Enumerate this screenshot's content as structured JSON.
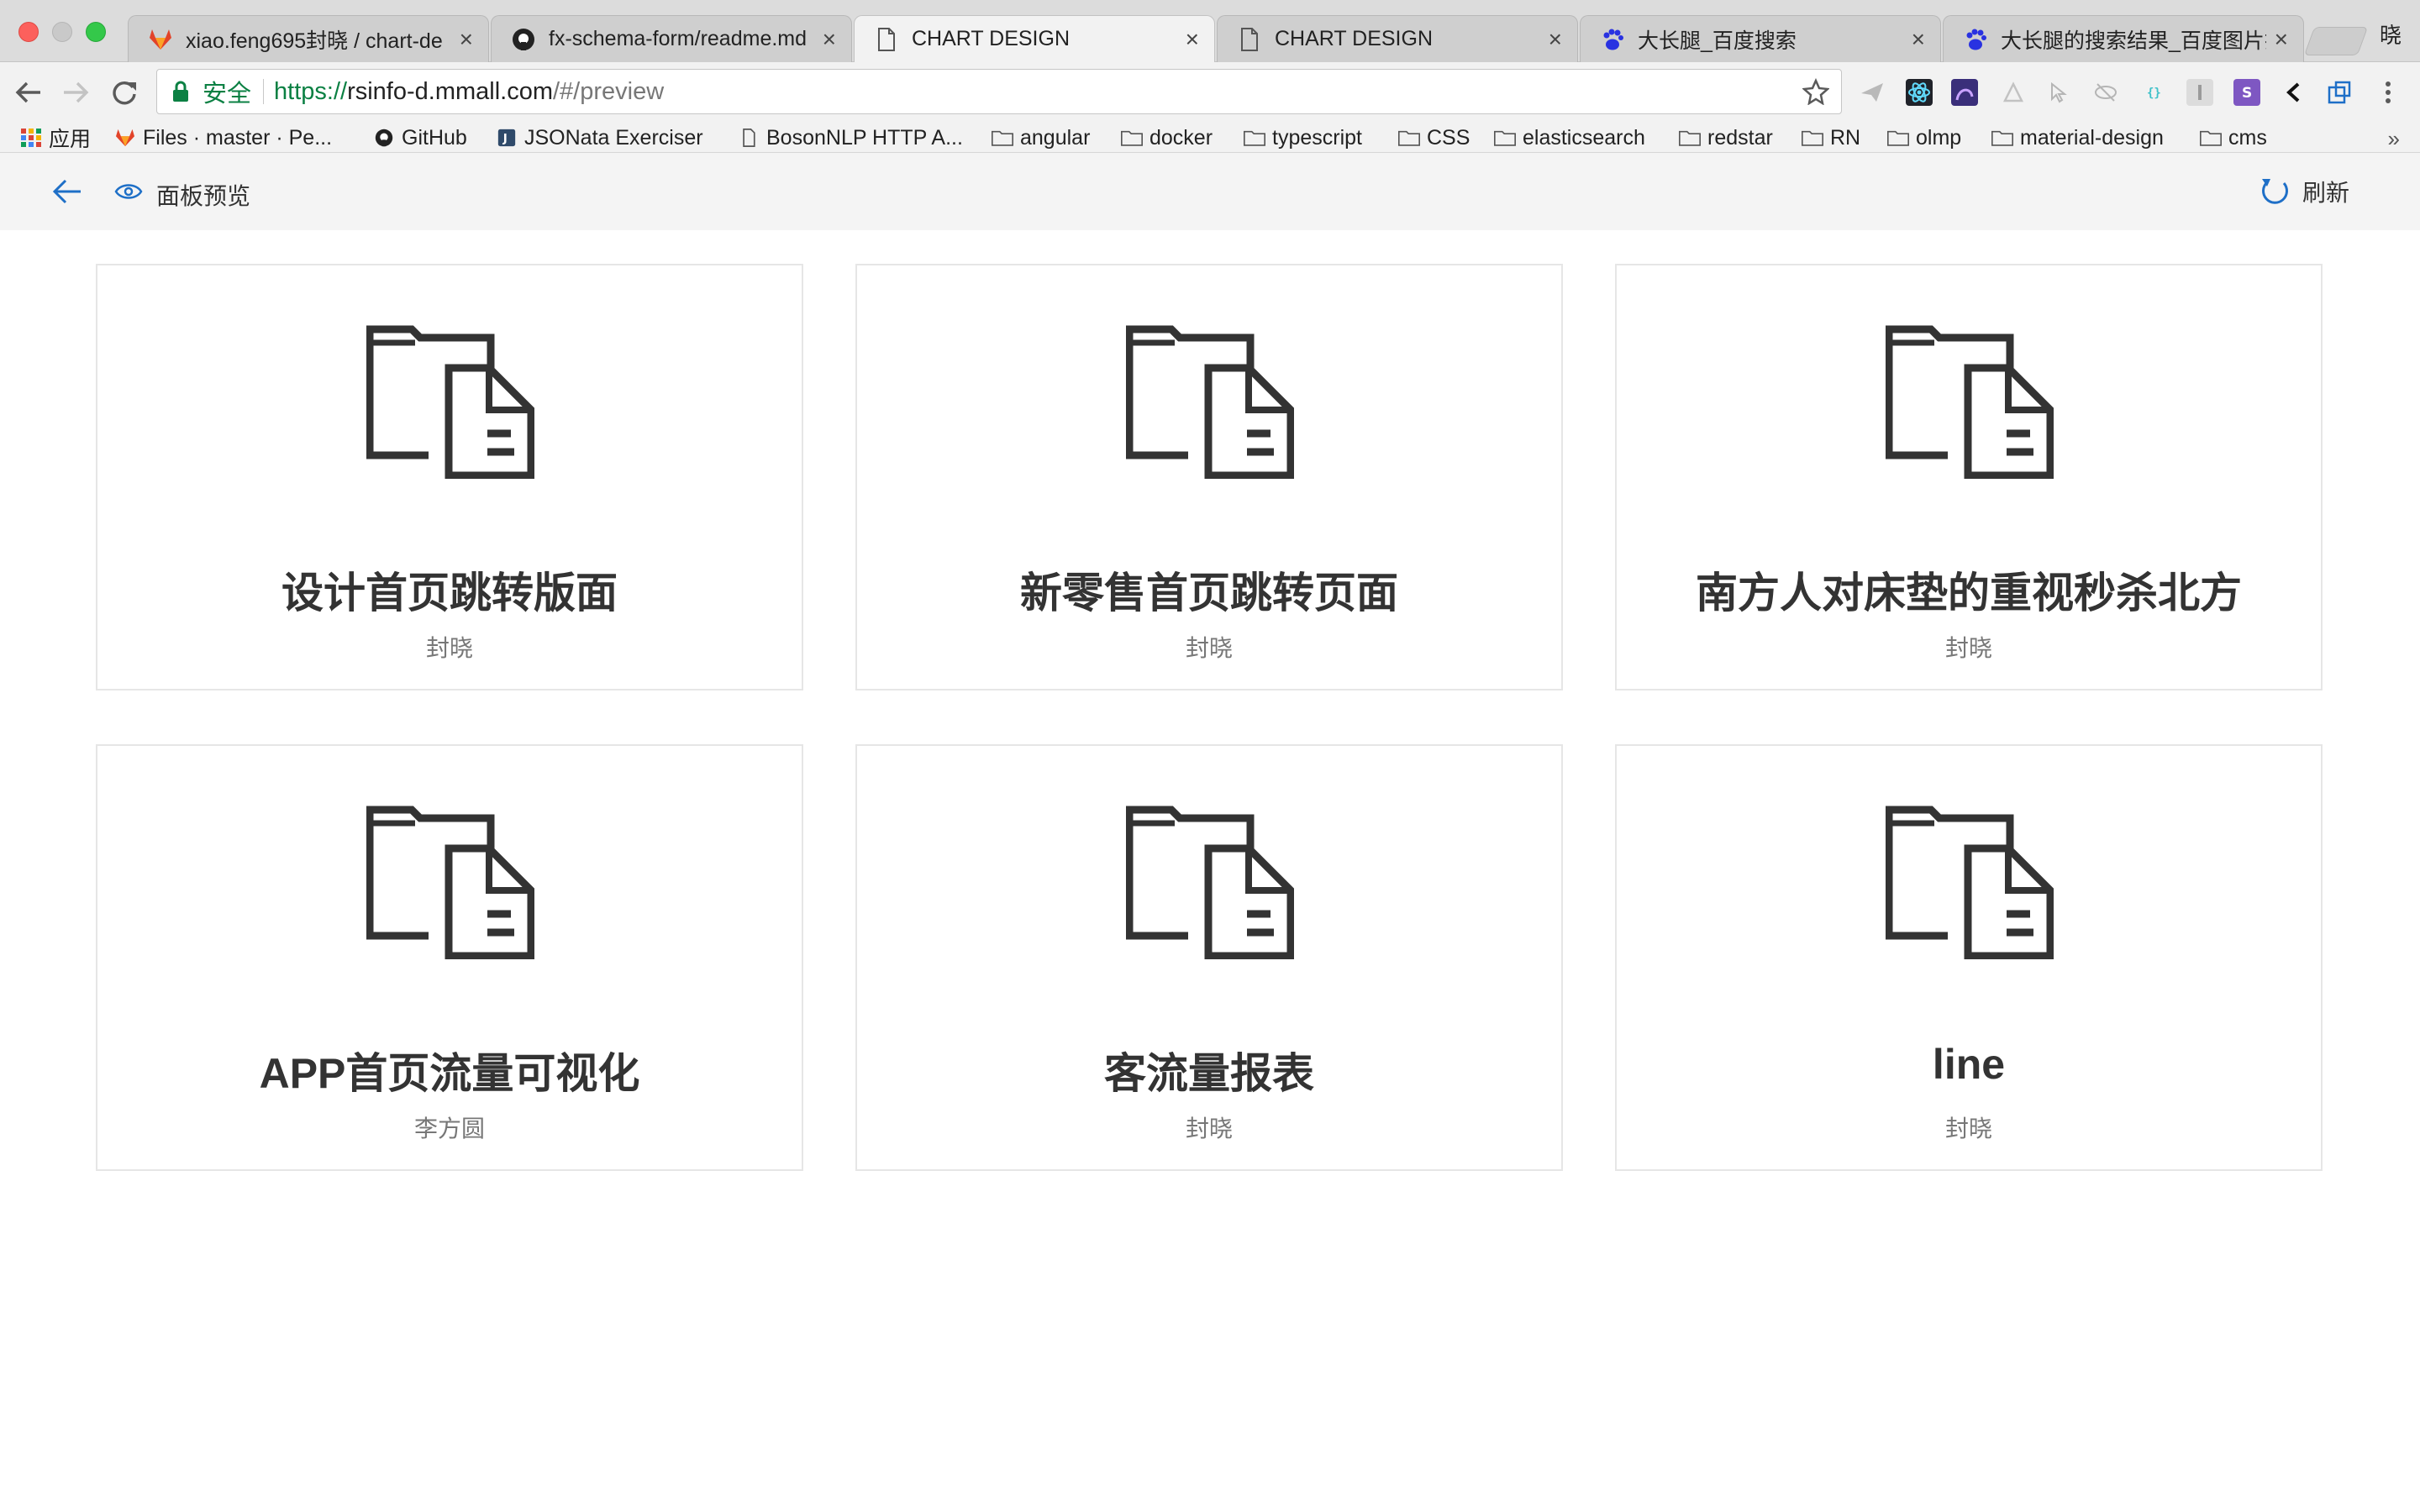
{
  "browser": {
    "profile_label": "晓",
    "tabs": [
      {
        "title": "xiao.feng695封晓 / chart-de",
        "icon": "gitlab-icon",
        "active": false
      },
      {
        "title": "fx-schema-form/readme.md",
        "icon": "github-icon",
        "active": false
      },
      {
        "title": "CHART DESIGN",
        "icon": "page-icon",
        "active": true
      },
      {
        "title": "CHART DESIGN",
        "icon": "page-icon",
        "active": false
      },
      {
        "title": "大长腿_百度搜索",
        "icon": "baidu-icon",
        "active": false
      },
      {
        "title": "大长腿的搜索结果_百度图片搜",
        "icon": "baidu-icon",
        "active": false
      }
    ],
    "omnibox": {
      "secure_label": "安全",
      "url_scheme": "https://",
      "url_host": "rsinfo-d.mmall.com",
      "url_path": "/#/preview"
    },
    "bookmarks": [
      {
        "label": "应用",
        "icon": "apps-grid-icon"
      },
      {
        "label": "Files · master · Pe...",
        "icon": "gitlab-icon"
      },
      {
        "label": "GitHub",
        "icon": "github-icon"
      },
      {
        "label": "JSONata Exerciser",
        "icon": "jsonata-icon"
      },
      {
        "label": "BosonNLP HTTP A...",
        "icon": "page-icon"
      },
      {
        "label": "angular",
        "icon": "folder-icon"
      },
      {
        "label": "docker",
        "icon": "folder-icon"
      },
      {
        "label": "typescript",
        "icon": "folder-icon"
      },
      {
        "label": "CSS",
        "icon": "folder-icon"
      },
      {
        "label": "elasticsearch",
        "icon": "folder-icon"
      },
      {
        "label": "redstar",
        "icon": "folder-icon"
      },
      {
        "label": "RN",
        "icon": "folder-icon"
      },
      {
        "label": "olmp",
        "icon": "folder-icon"
      },
      {
        "label": "material-design",
        "icon": "folder-icon"
      },
      {
        "label": "cms",
        "icon": "folder-icon"
      }
    ],
    "bookmarks_more": "»"
  },
  "app": {
    "title": "面板预览",
    "refresh_label": "刷新",
    "accent_color": "#1e6fc7",
    "cards": [
      {
        "name": "设计首页跳转版面",
        "author": "封晓"
      },
      {
        "name": "新零售首页跳转页面",
        "author": "封晓"
      },
      {
        "name": "南方人对床垫的重视秒杀北方",
        "author": "封晓"
      },
      {
        "name": "APP首页流量可视化",
        "author": "李方圆"
      },
      {
        "name": "客流量报表",
        "author": "封晓"
      },
      {
        "name": "line",
        "author": "封晓"
      }
    ]
  }
}
